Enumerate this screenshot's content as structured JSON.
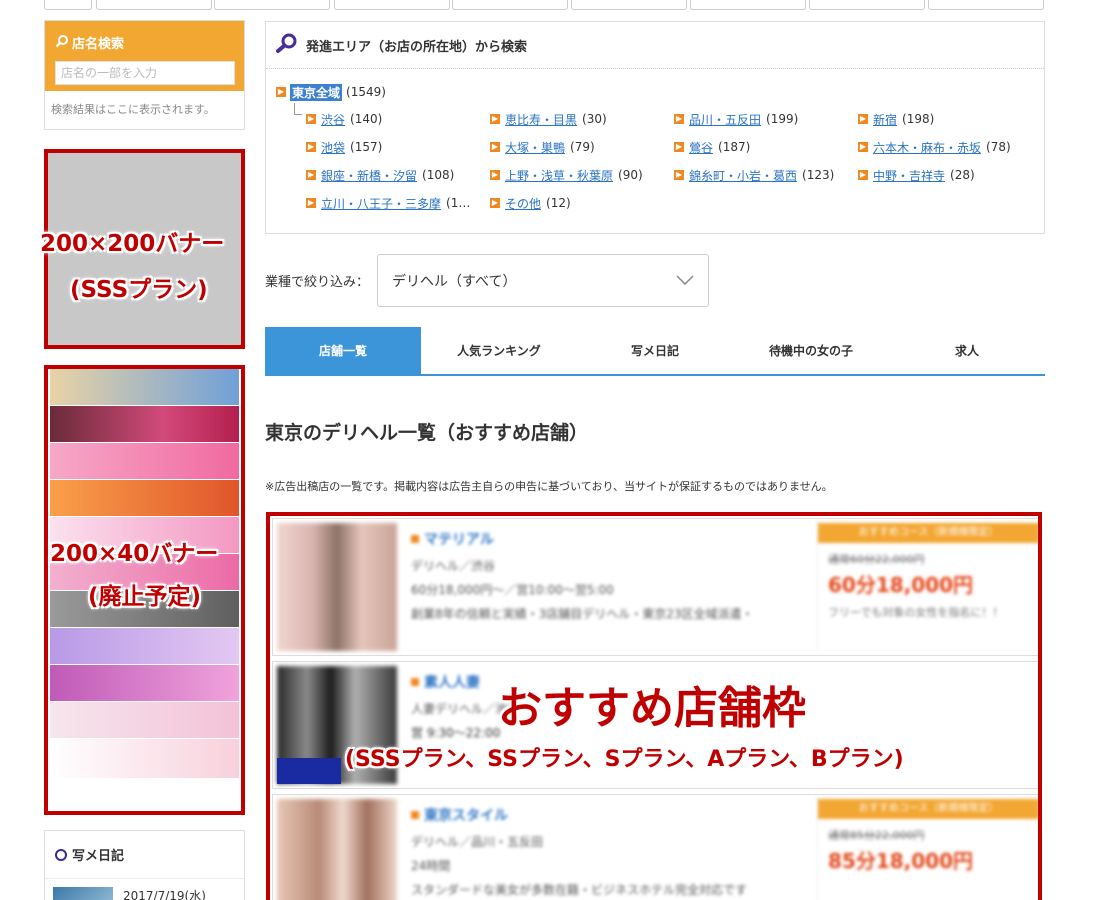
{
  "shop_search": {
    "title": "店名検索",
    "placeholder": "店名の一部を入力",
    "result_text": "検索結果はここに表示されます。"
  },
  "banner_labels": {
    "big_line1": "200×200バナー",
    "big_line2": "(SSSプラン)",
    "tall_line1": "200×40バナー",
    "tall_line2": "(廃止予定)",
    "shop_line1": "おすすめ店舗枠",
    "shop_line2": "(SSSプラン、SSプラン、Sプラン、Aプラン、Bプラン)"
  },
  "photo_diary": {
    "title": "写メ日記",
    "first_date": "2017/7/19(水)"
  },
  "area_search": {
    "title": "発進エリア（お店の所在地）から検索",
    "root": {
      "name": "東京全域",
      "count": "(1549)"
    },
    "areas": [
      {
        "name": "渋谷",
        "count": "(140)"
      },
      {
        "name": "恵比寿・目黒",
        "count": "(30)"
      },
      {
        "name": "品川・五反田",
        "count": "(199)"
      },
      {
        "name": "新宿",
        "count": "(198)"
      },
      {
        "name": "池袋",
        "count": "(157)"
      },
      {
        "name": "大塚・巣鴨",
        "count": "(79)"
      },
      {
        "name": "鶯谷",
        "count": "(187)"
      },
      {
        "name": "六本木・麻布・赤坂",
        "count": "(78)"
      },
      {
        "name": "銀座・新橋・汐留",
        "count": "(108)"
      },
      {
        "name": "上野・浅草・秋葉原",
        "count": "(90)"
      },
      {
        "name": "錦糸町・小岩・葛西",
        "count": "(123)"
      },
      {
        "name": "中野・吉祥寺",
        "count": "(28)"
      },
      {
        "name": "立川・八王子・三多摩",
        "count": "(1…"
      },
      {
        "name": "その他",
        "count": "(12)"
      }
    ]
  },
  "filter": {
    "label": "業種で絞り込み：",
    "selected": "デリヘル（すべて）"
  },
  "tabs": [
    "店舗一覧",
    "人気ランキング",
    "写メ日記",
    "待機中の女の子",
    "求人"
  ],
  "list_heading": "東京のデリヘル一覧（おすすめ店舗）",
  "notice": "※広告出稿店の一覧です。掲載内容は広告主自らの申告に基づいており、当サイトが保証するものではありません。",
  "shops": [
    {
      "name": "マテリアル",
      "category": "デリヘル／渋谷",
      "hours": "60分18,000円～／営10:00～翌5:00",
      "desc": "創業8年の信頼と実績・3店舗目デリヘル・東京23区全域派遣・",
      "price_tag": "おすすめコース（新規様限定）",
      "price_old": "通常60分22,000円",
      "price": "60分18,000円",
      "price_note": "フリーでも対象の女性を指名に！！"
    },
    {
      "name": "素人人妻",
      "category": "人妻デリヘル／池袋",
      "hours": "営 9:30～22:00",
      "desc": ""
    },
    {
      "name": "東京スタイル",
      "category": "デリヘル／品川・五反田",
      "hours": "24時間",
      "desc": "スタンダードな美女が多数在籍・ビジネスホテル完全対応です",
      "price_tag": "おすすめコース（新規様限定）",
      "price_old": "通常85分22,000円",
      "price": "85分18,000円",
      "price_note": ""
    }
  ],
  "colors": {
    "accent_orange": "#f3a733",
    "tab_blue": "#3b95d8",
    "annotation_red": "#c00000",
    "price_red": "#e2471a",
    "link_blue": "#2a73c4"
  }
}
